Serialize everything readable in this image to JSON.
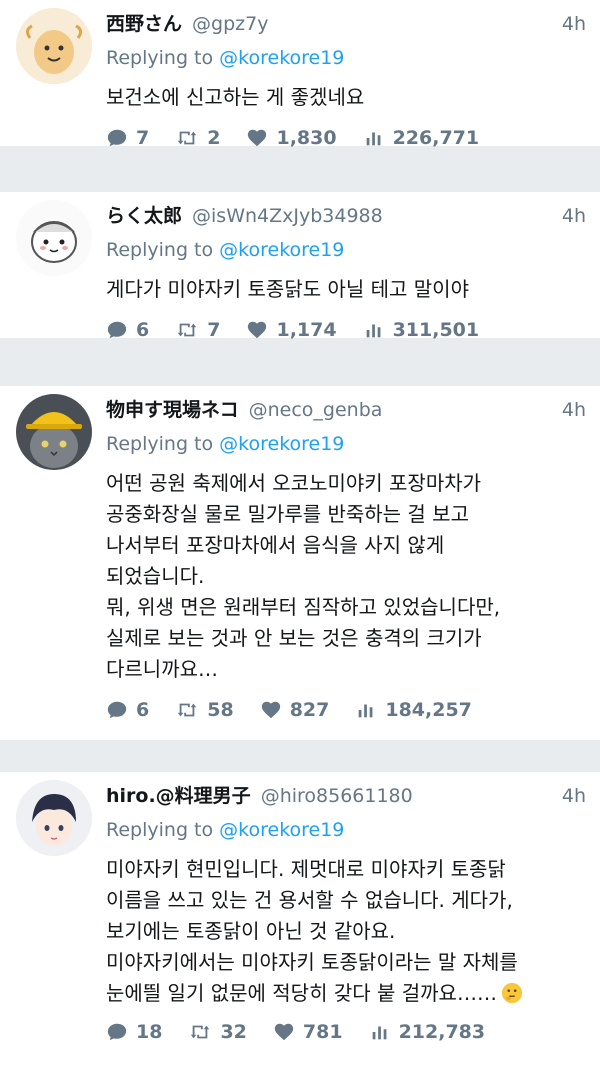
{
  "tweets": [
    {
      "name": "西野さん",
      "handle": "@gpz7y",
      "time": "4h",
      "reply_prefix": "Replying to ",
      "reply_to": "@korekore19",
      "text": "보건소에 신고하는 게 좋겠네요",
      "replies": "7",
      "retweets": "2",
      "likes": "1,830",
      "views": "226,771"
    },
    {
      "name": "らく太郎",
      "handle": "@isWn4ZxJyb34988",
      "time": "4h",
      "reply_prefix": "Replying to ",
      "reply_to": "@korekore19",
      "text": "게다가 미야자키 토종닭도 아닐 테고 말이야",
      "replies": "6",
      "retweets": "7",
      "likes": "1,174",
      "views": "311,501"
    },
    {
      "name": "物申す現場ネコ",
      "handle": "@neco_genba",
      "time": "4h",
      "reply_prefix": "Replying to ",
      "reply_to": "@korekore19",
      "text": "어떤 공원 축제에서 오코노미야키 포장마차가\n공중화장실 물로 밀가루를 반죽하는 걸 보고\n나서부터 포장마차에서 음식을 사지 않게\n되었습니다.\n뭐, 위생 면은 원래부터 짐작하고 있었습니다만,\n실제로 보는 것과 안 보는 것은 충격의 크기가\n다르니까요…",
      "replies": "6",
      "retweets": "58",
      "likes": "827",
      "views": "184,257"
    },
    {
      "name": "hiro.@料理男子",
      "handle": "@hiro85661180",
      "time": "4h",
      "reply_prefix": "Replying to ",
      "reply_to": "@korekore19",
      "text": "미야자키 현민입니다. 제멋대로 미야자키 토종닭\n이름을 쓰고 있는 건 용서할 수 없습니다. 게다가,\n보기에는 토종닭이 아닌 것 같아요.\n미야자키에서는 미야자키 토종닭이라는 말 자체를\n눈에띌 일기 없문에 적당히 갖다 붙 걸까요……",
      "emoji": "thinking-face",
      "replies": "18",
      "retweets": "32",
      "likes": "781",
      "views": "212,783"
    }
  ],
  "icons": {
    "reply": "reply-bubble-icon",
    "retweet": "retweet-icon",
    "like": "heart-icon",
    "views": "views-bar-chart-icon"
  },
  "colors": {
    "link": "#1da1f2",
    "muted": "#657786",
    "text": "#14171a",
    "separator": "#e8ecef"
  }
}
